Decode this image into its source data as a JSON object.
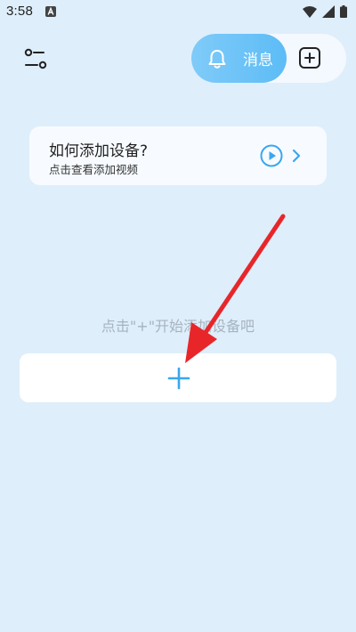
{
  "status_bar": {
    "time": "3:58",
    "icons": [
      "notification-a-icon",
      "wifi-icon",
      "signal-icon",
      "battery-icon"
    ]
  },
  "header": {
    "settings_icon": "sliders-icon",
    "messages_label": "消息",
    "messages_icon": "bell-icon",
    "add_icon": "plus-square-icon"
  },
  "help_card": {
    "title": "如何添加设备?",
    "subtitle": "点击查看添加视频",
    "play_icon": "play-circle-icon",
    "chevron_icon": "chevron-right-icon"
  },
  "empty_state": {
    "hint": "点击\"+\"开始添加设备吧",
    "add_icon": "plus-icon"
  },
  "colors": {
    "background": "#deeefb",
    "accent": "#5dbcf6",
    "arrow": "#e8262a"
  }
}
